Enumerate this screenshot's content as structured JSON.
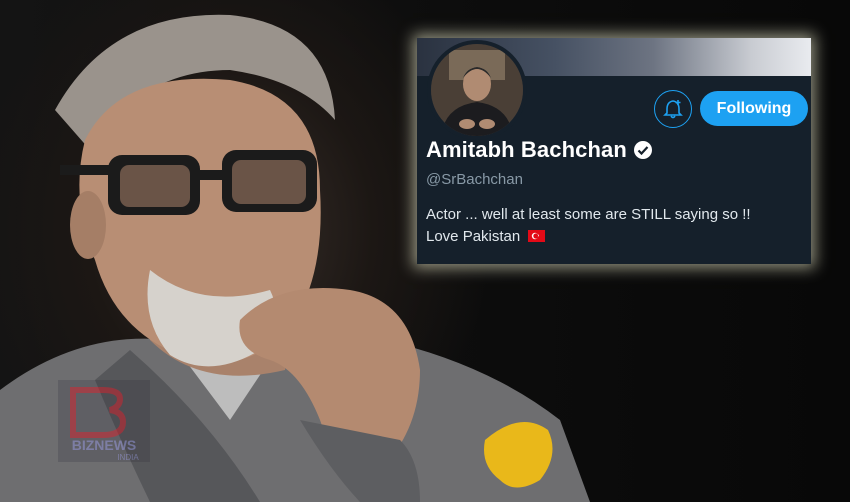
{
  "profile": {
    "display_name": "Amitabh Bachchan",
    "handle": "@SrBachchan",
    "bio_line1": "Actor ... well at least some are STILL saying so !!",
    "bio_line2": "Love Pakistan",
    "verified_icon": "verified-badge-icon",
    "flag_icon": "turkey-flag-emoji"
  },
  "actions": {
    "follow_label": "Following",
    "notify_icon": "bell-plus-icon"
  },
  "colors": {
    "card_bg": "#15202b",
    "accent": "#1da1f2",
    "handle": "#8899a6"
  },
  "watermark": {
    "text": "BIZNEWS",
    "subtext": "INDIA"
  }
}
